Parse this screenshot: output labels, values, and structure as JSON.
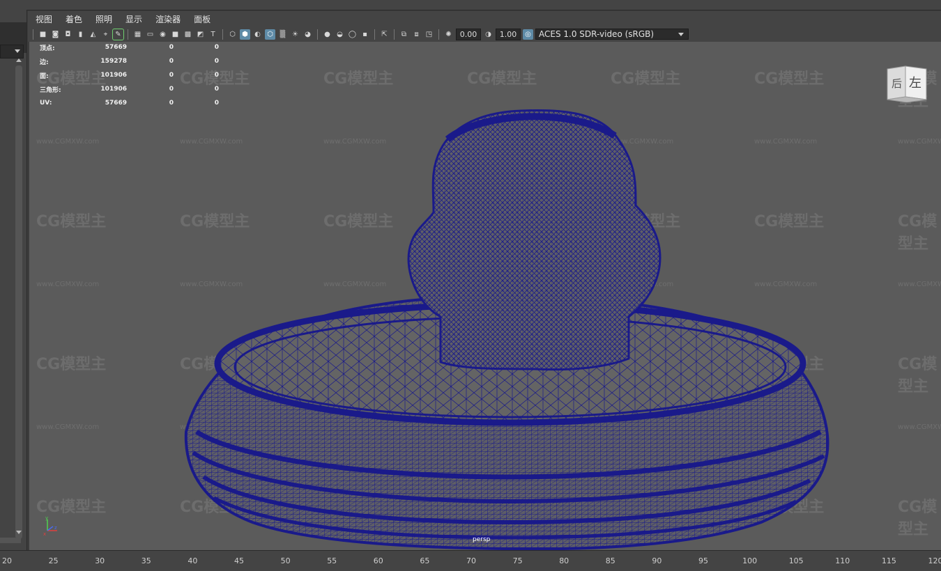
{
  "menu": [
    "视图",
    "着色",
    "照明",
    "显示",
    "渲染器",
    "面板"
  ],
  "toolbar": {
    "exposure_value": "0.00",
    "gamma_value": "1.00",
    "colorspace": "ACES 1.0 SDR-video (sRGB)"
  },
  "hud": {
    "rows": [
      {
        "label": "顶点:",
        "v1": "57669",
        "v2": "0",
        "v3": "0"
      },
      {
        "label": "边:",
        "v1": "159278",
        "v2": "0",
        "v3": "0"
      },
      {
        "label": "面:",
        "v1": "101906",
        "v2": "0",
        "v3": "0"
      },
      {
        "label": "三角形:",
        "v1": "101906",
        "v2": "0",
        "v3": "0"
      },
      {
        "label": "UV:",
        "v1": "57669",
        "v2": "0",
        "v3": "0"
      }
    ]
  },
  "viewcube": {
    "back": "后",
    "left": "左"
  },
  "camera_label": "persp",
  "axis": {
    "y": "y",
    "x": "x",
    "z": "z"
  },
  "timeline": {
    "ticks": [
      "20",
      "25",
      "30",
      "35",
      "40",
      "45",
      "50",
      "55",
      "60",
      "65",
      "70",
      "75",
      "80",
      "85",
      "90",
      "95",
      "100",
      "105",
      "110",
      "115",
      "120"
    ]
  },
  "watermark": {
    "logo": "CG模型主",
    "url": "www.CGMXW.com"
  },
  "colors": {
    "wireframe": "#1a1a8a",
    "viewport_bg": "#5b5b5b",
    "toolbar_active": "#5e8ba7"
  }
}
